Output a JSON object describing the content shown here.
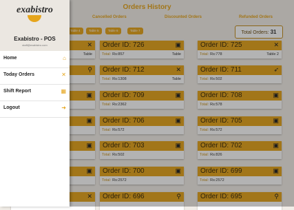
{
  "header": {
    "title": "Orders History"
  },
  "status_tabs": [
    "Cancelled Orders",
    "Discounted Orders",
    "Refunded Orders"
  ],
  "table_chips": [
    "Table 4",
    "Table 5",
    "Table 6",
    "Table 7"
  ],
  "total_orders": {
    "label": "Total Orders:",
    "value": "31"
  },
  "colors": {
    "accent": "#e6a51c",
    "drawer_bg": "#ebe7e1"
  },
  "orders_left": [
    {
      "id": "Order ID: 726",
      "total_label": "Total:",
      "amount": "Rs:857",
      "type": "Table",
      "icon": "bag-icon"
    },
    {
      "id": "Order ID: 712",
      "total_label": "Total:",
      "amount": "Rs:1308",
      "type": "Table",
      "icon": "cutlery-icon"
    },
    {
      "id": "Order ID: 709",
      "total_label": "Total:",
      "amount": "Rs:2362",
      "type": "",
      "icon": "bag-icon"
    },
    {
      "id": "Order ID: 706",
      "total_label": "Total:",
      "amount": "Rs:572",
      "type": "",
      "icon": "bag-icon"
    },
    {
      "id": "Order ID: 703",
      "total_label": "Total:",
      "amount": "Rs:502",
      "type": "",
      "icon": "bag-icon"
    },
    {
      "id": "Order ID: 700",
      "total_label": "Total:",
      "amount": "Rs:2572",
      "type": "",
      "icon": "bag-icon"
    },
    {
      "id": "Order ID: 696",
      "total_label": "",
      "amount": "",
      "type": "",
      "icon": "bike-icon"
    }
  ],
  "orders_right": [
    {
      "id": "Order ID: 725",
      "total_label": "Total:",
      "amount": "Rs:778",
      "type": "Table 2",
      "icon": "cutlery-icon"
    },
    {
      "id": "Order ID: 711",
      "total_label": "Total:",
      "amount": "Rs:502",
      "type": "",
      "icon": "delivery-icon"
    },
    {
      "id": "Order ID: 708",
      "total_label": "Total:",
      "amount": "Rs:578",
      "type": "",
      "icon": "bag-icon"
    },
    {
      "id": "Order ID: 705",
      "total_label": "Total:",
      "amount": "Rs:572",
      "type": "",
      "icon": "bag-icon"
    },
    {
      "id": "Order ID: 702",
      "total_label": "Total:",
      "amount": "Rs:826",
      "type": "",
      "icon": "bag-icon"
    },
    {
      "id": "Order ID: 699",
      "total_label": "Total:",
      "amount": "Rs:2572",
      "type": "",
      "icon": "bag-icon"
    },
    {
      "id": "Order ID: 695",
      "total_label": "",
      "amount": "",
      "type": "",
      "icon": "bike-icon"
    }
  ],
  "partial_column": [
    {
      "type": "Table",
      "icon": "cutlery-icon"
    },
    {
      "type": "",
      "icon": "bike-icon"
    },
    {
      "type": "",
      "icon": "bag-icon"
    },
    {
      "type": "",
      "icon": "bag-icon"
    },
    {
      "type": "",
      "icon": "bag-icon"
    },
    {
      "type": "",
      "icon": "bag-icon"
    },
    {
      "type": "",
      "icon": "cutlery-icon"
    }
  ],
  "drawer": {
    "logo": "exabistro",
    "title": "Exabistro - POS",
    "subtitle": "staff@exabistro.com",
    "menu": [
      {
        "label": "Home",
        "icon": "home-icon"
      },
      {
        "label": "Today Orders",
        "icon": "cutlery-icon"
      },
      {
        "label": "Shift Report",
        "icon": "calendar-icon"
      },
      {
        "label": "Logout",
        "icon": "logout-icon"
      }
    ]
  }
}
